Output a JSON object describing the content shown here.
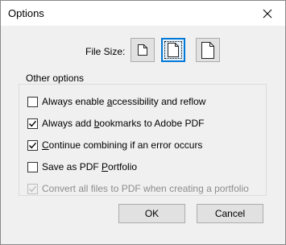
{
  "window": {
    "title": "Options",
    "close_icon": "close-icon"
  },
  "file_size": {
    "label": "File Size:",
    "options": [
      {
        "icon": "small-page-icon",
        "selected": false
      },
      {
        "icon": "medium-page-icon",
        "selected": true
      },
      {
        "icon": "large-page-icon",
        "selected": false
      }
    ]
  },
  "other_options": {
    "legend": "Other options",
    "items": [
      {
        "pre": "Always enable ",
        "accel": "a",
        "post": "ccessibility and reflow",
        "checked": false,
        "disabled": false
      },
      {
        "pre": "Always add ",
        "accel": "b",
        "post": "ookmarks to Adobe PDF",
        "checked": true,
        "disabled": false
      },
      {
        "pre": "",
        "accel": "C",
        "post": "ontinue combining if an error occurs",
        "checked": true,
        "disabled": false
      },
      {
        "pre": "Save as PDF ",
        "accel": "P",
        "post": "ortfolio",
        "checked": false,
        "disabled": false
      },
      {
        "pre": "Convert all files to PDF when creating a portfolio",
        "accel": "",
        "post": "",
        "checked": true,
        "disabled": true
      }
    ]
  },
  "buttons": {
    "ok": "OK",
    "cancel": "Cancel"
  },
  "colors": {
    "accent": "#0078d7",
    "disabled_text": "#8d8d8d"
  }
}
